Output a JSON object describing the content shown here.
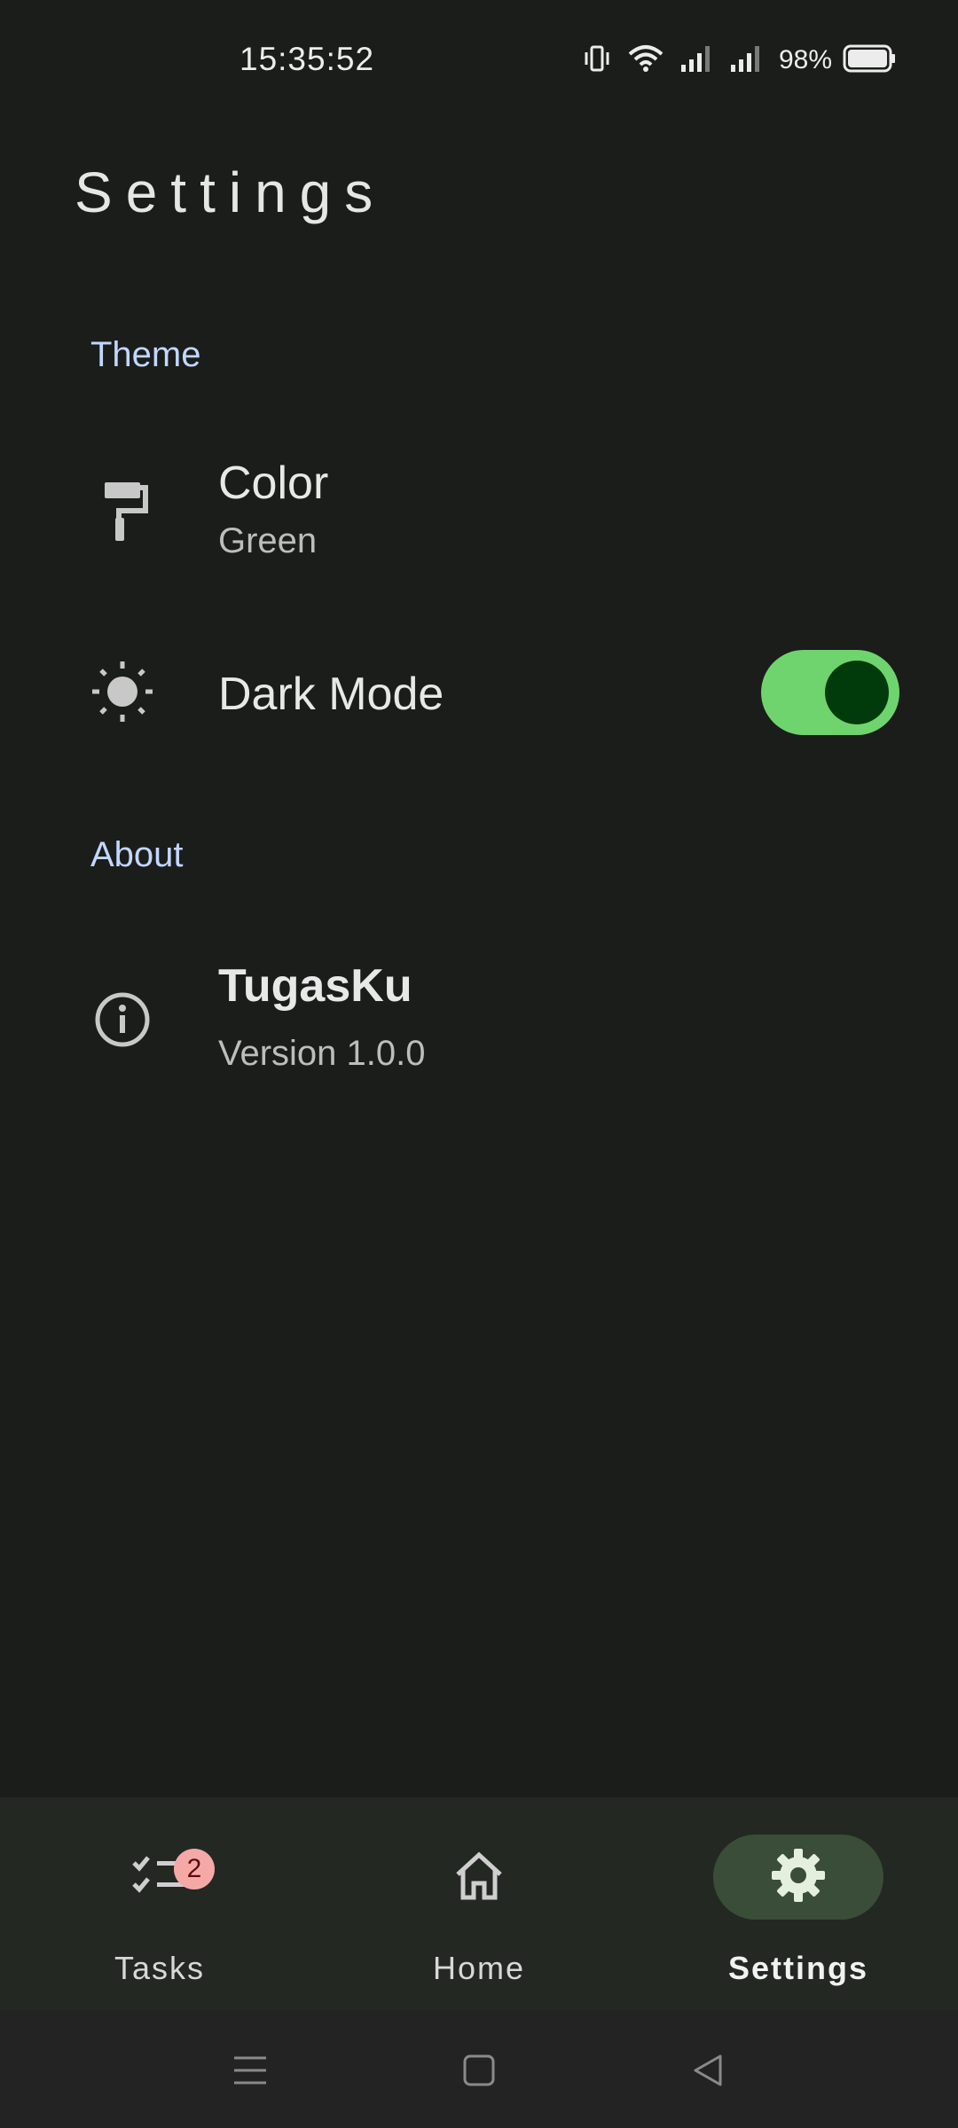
{
  "status_bar": {
    "time": "15:35:52",
    "battery_percent": "98%",
    "icons": [
      "vibrate-icon",
      "wifi-icon",
      "signal-icon",
      "signal-icon",
      "battery-icon"
    ]
  },
  "page": {
    "title": "Settings"
  },
  "sections": {
    "theme": {
      "header": "Theme",
      "color": {
        "title": "Color",
        "value": "Green",
        "icon": "paint-roller-icon"
      },
      "dark_mode": {
        "title": "Dark Mode",
        "enabled": true,
        "icon": "brightness-icon"
      }
    },
    "about": {
      "header": "About",
      "app": {
        "name": "TugasKu",
        "version": "Version 1.0.0",
        "icon": "info-icon"
      }
    }
  },
  "bottom_nav": {
    "items": [
      {
        "label": "Tasks",
        "icon": "tasks-checklist-icon",
        "badge": "2",
        "active": false
      },
      {
        "label": "Home",
        "icon": "home-icon",
        "active": false
      },
      {
        "label": "Settings",
        "icon": "gear-icon",
        "active": true
      }
    ]
  },
  "system_nav": {
    "buttons": [
      "menu-icon",
      "home-square-icon",
      "back-triangle-icon"
    ]
  },
  "colors": {
    "background": "#1a1d1a",
    "accent": "#6fd46d",
    "toggle_knob": "#013b0c",
    "section_header": "#c3d7ff",
    "nav_background": "#232823",
    "nav_active_pill": "#3a4d38",
    "badge": "#f5a9a7"
  }
}
